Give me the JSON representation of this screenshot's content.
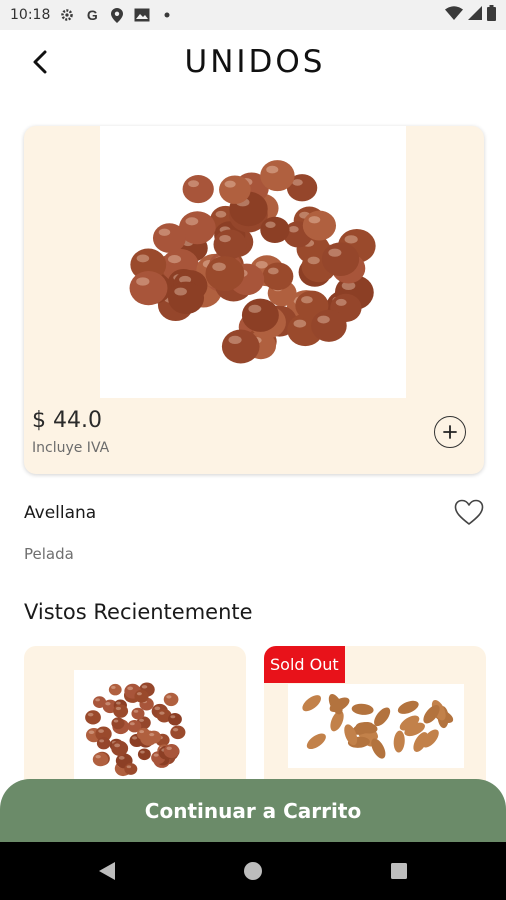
{
  "status_bar": {
    "time": "10:18",
    "icons": [
      "settings-icon",
      "google-icon",
      "location-icon",
      "image-icon",
      "dot-icon"
    ],
    "right_icons": [
      "wifi-icon",
      "signal-icon",
      "battery-icon"
    ]
  },
  "header": {
    "brand": "UNIDOS",
    "back_icon": "back-arrow-icon"
  },
  "product": {
    "price": "$ 44.0",
    "tax_note": "Incluye IVA",
    "name": "Avellana",
    "variant": "Pelada",
    "add_icon": "plus-icon",
    "favorite_icon": "heart-icon"
  },
  "recent": {
    "title": "Vistos Recientemente",
    "items": [
      {
        "image": "hazelnuts-image"
      },
      {
        "image": "almonds-image",
        "badge": "Sold Out"
      }
    ]
  },
  "cta": {
    "label": "Continuar a Carrito"
  },
  "nav": [
    "back-triangle-icon",
    "home-circle-icon",
    "recents-square-icon"
  ],
  "colors": {
    "card_bg": "#fdf3e4",
    "cta_bg": "#6b8b69",
    "badge_bg": "#e8121a",
    "status_bg": "#f1f1f1"
  }
}
